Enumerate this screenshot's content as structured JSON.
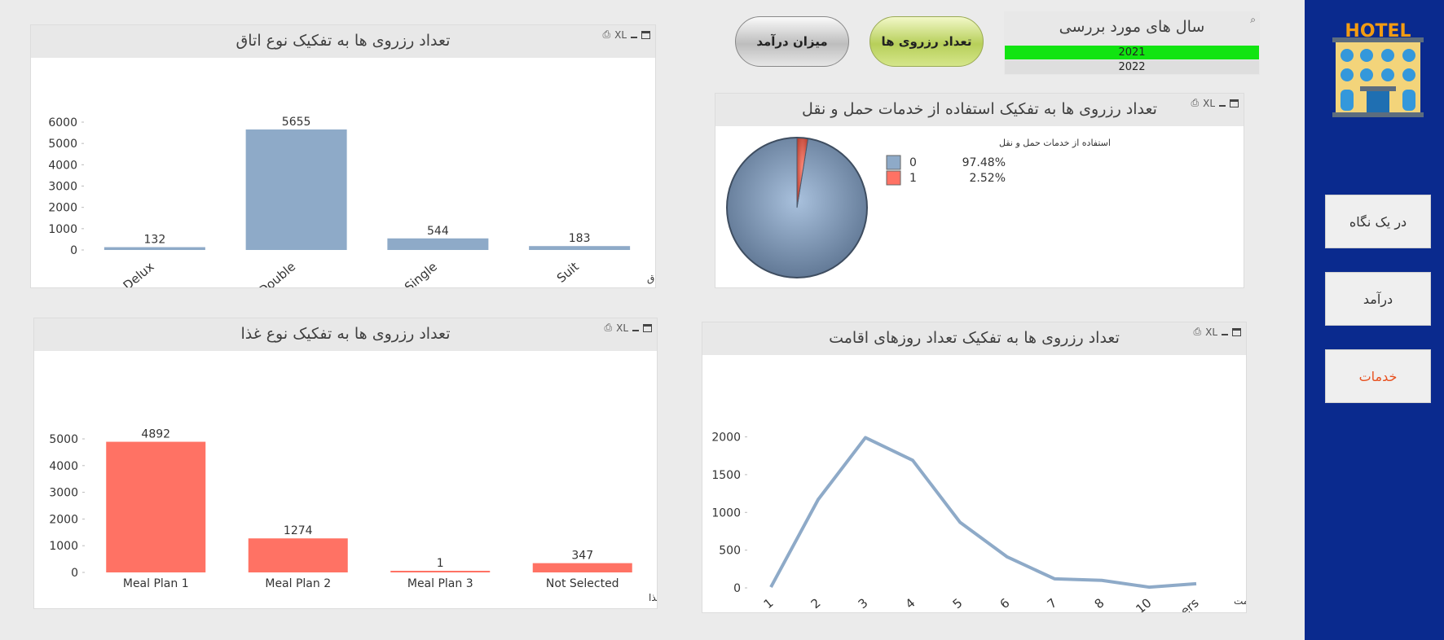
{
  "colors": {
    "blue": "#8eaac8",
    "red": "#ff7264",
    "green": "#11e411",
    "sidebar": "#0a2a8e",
    "active_nav": "#e8501e"
  },
  "icons": [
    "print-icon",
    "xl-export-icon",
    "minimize-icon",
    "maximize-icon",
    "search-icon",
    "hotel-logo-icon"
  ],
  "toolbar": {
    "print_glyph": "⎙",
    "xl_label": "XL"
  },
  "logo": {
    "text": "HOTEL"
  },
  "nav": {
    "items": [
      "در یک نگاه",
      "درآمد",
      "خدمات"
    ],
    "active_index": 2
  },
  "buttons": {
    "reservations": "تعداد رزروی ها",
    "revenue": "میزان درآمد"
  },
  "years": {
    "title": "سال های مورد بررسی",
    "items": [
      "2021",
      "2022"
    ],
    "selected": "2021"
  },
  "panels": {
    "room": {
      "title": "تعداد رزروی ها به تفکیک نوع اتاق"
    },
    "meal": {
      "title": "تعداد رزروی ها به تفکیک نوع غذا"
    },
    "transport": {
      "title": "تعداد رزروی ها به تفکیک استفاده از خدمات حمل و نقل"
    },
    "stay": {
      "title": "تعداد رزروی ها به تفکیک تعداد روزهای اقامت"
    }
  },
  "chart_data": [
    {
      "id": "room",
      "type": "bar",
      "categories": [
        "Delux",
        "Double",
        "Single",
        "Suit"
      ],
      "values": [
        132,
        5655,
        544,
        183
      ],
      "xlabel": "نوع اتاق",
      "ylabel": "",
      "ylim": [
        0,
        6000
      ],
      "yticks": [
        0,
        1000,
        2000,
        3000,
        4000,
        5000,
        6000
      ],
      "color": "#8eaac8",
      "grid": false
    },
    {
      "id": "meal",
      "type": "bar",
      "categories": [
        "Meal Plan 1",
        "Meal Plan 2",
        "Meal Plan 3",
        "Not Selected"
      ],
      "values": [
        4892,
        1274,
        1,
        347
      ],
      "xlabel": "نوع غذا",
      "ylabel": "",
      "ylim": [
        0,
        5000
      ],
      "yticks": [
        0,
        1000,
        2000,
        3000,
        4000,
        5000
      ],
      "color": "#ff7264",
      "grid": false
    },
    {
      "id": "transport",
      "type": "pie",
      "legend_title": "استفاده از خدمات حمل و نقل",
      "legend_position": "right",
      "slices": [
        {
          "label": "0",
          "value": 97.48,
          "pct_label": "97.48%",
          "color": "#8eaac8"
        },
        {
          "label": "1",
          "value": 2.52,
          "pct_label": "2.52%",
          "color": "#ff7264"
        }
      ]
    },
    {
      "id": "stay",
      "type": "line",
      "x": [
        "1",
        "2",
        "3",
        "4",
        "5",
        "6",
        "7",
        "8",
        "10",
        "Others"
      ],
      "series": [
        {
          "values": [
            10,
            1170,
            1990,
            1690,
            870,
            410,
            120,
            100,
            10,
            55
          ]
        }
      ],
      "xlabel": "تعداد روزهای اقامت",
      "ylabel": "",
      "ylim": [
        0,
        2200
      ],
      "yticks": [
        0,
        500,
        1000,
        1500,
        2000
      ],
      "color": "#8eaac8",
      "grid": false
    }
  ]
}
